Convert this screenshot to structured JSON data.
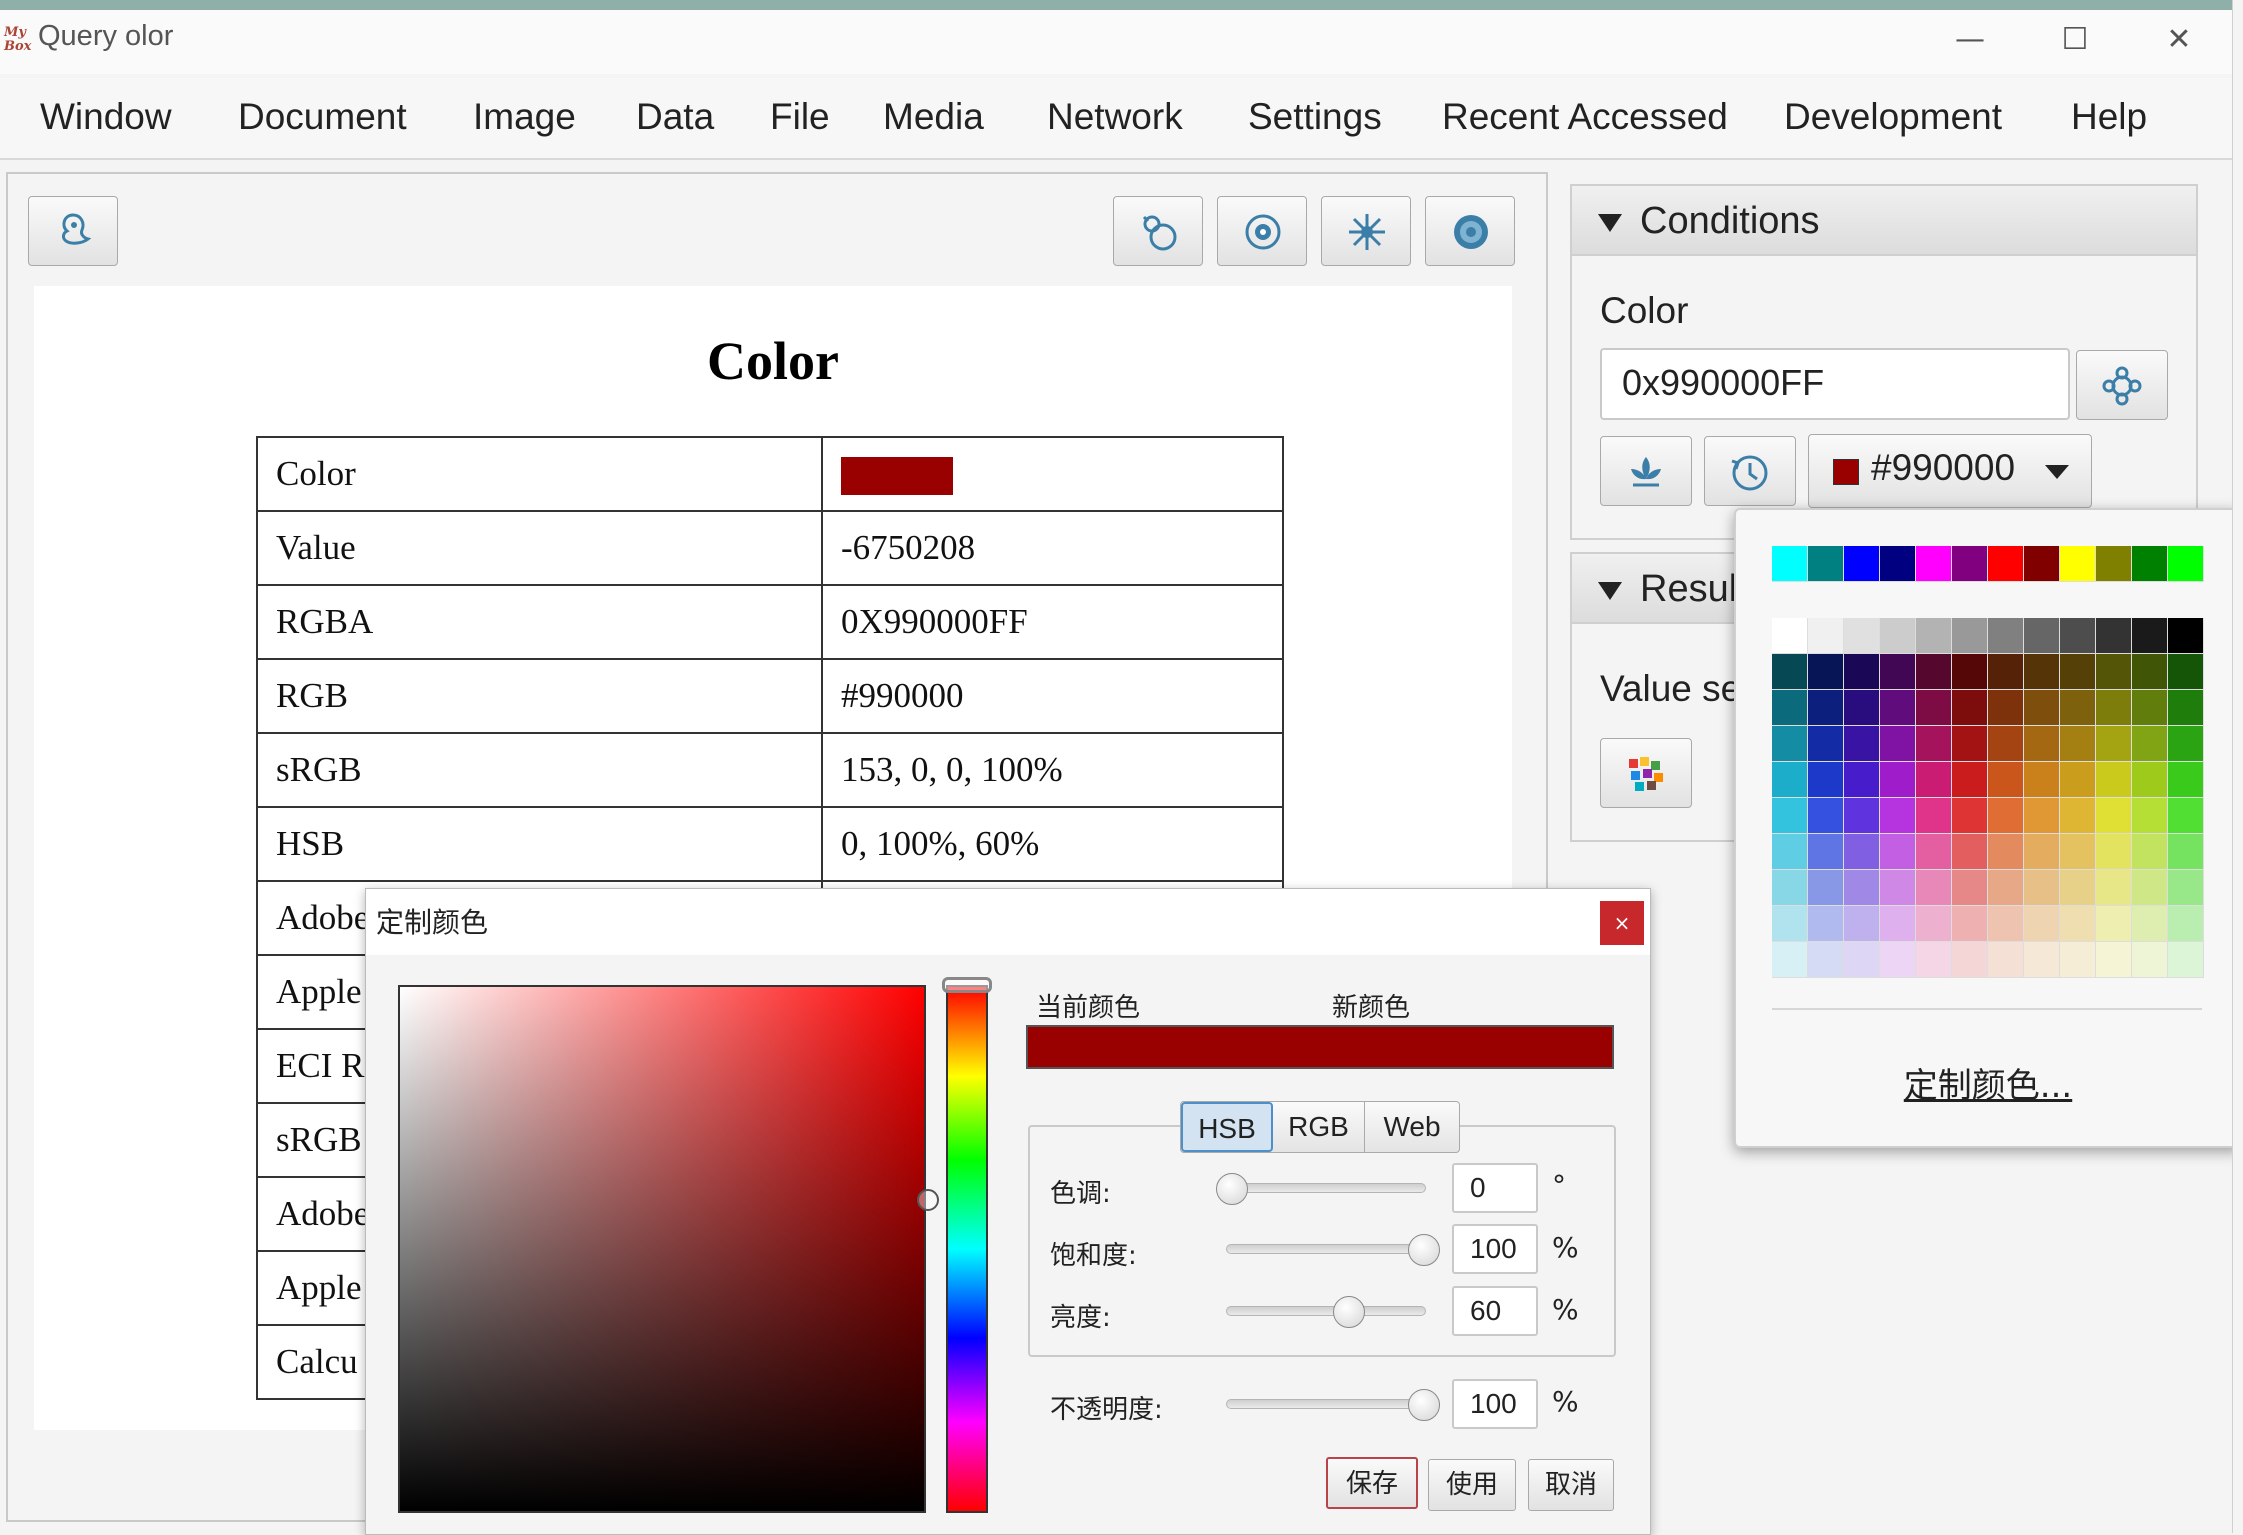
{
  "window": {
    "title": "Query olor",
    "logo_text": "My Box"
  },
  "menu": [
    "Window",
    "Document",
    "Image",
    "Data",
    "File",
    "Media",
    "Network",
    "Settings",
    "Recent Accessed",
    "Development",
    "Help"
  ],
  "document": {
    "heading": "Color",
    "rows": [
      {
        "key": "Color",
        "value": ""
      },
      {
        "key": "Value",
        "value": "-6750208"
      },
      {
        "key": "RGBA",
        "value": "0X990000FF"
      },
      {
        "key": "RGB",
        "value": "#990000"
      },
      {
        "key": "sRGB",
        "value": "153, 0, 0, 100%"
      },
      {
        "key": "HSB",
        "value": "0, 100%, 60%"
      },
      {
        "key": "Adobe",
        "value": ""
      },
      {
        "key": "Apple",
        "value": ""
      },
      {
        "key": "ECI R",
        "value": ""
      },
      {
        "key": "sRGB",
        "value": ""
      },
      {
        "key": "Adobe",
        "value": ""
      },
      {
        "key": "Apple",
        "value": ""
      },
      {
        "key": "Calcu",
        "value": ""
      }
    ],
    "swatch_color": "#990000"
  },
  "conditions": {
    "header": "Conditions",
    "color_label": "Color",
    "color_value": "0x990000FF",
    "picker_value": "#990000"
  },
  "results": {
    "header": "Resul",
    "value_label": "Value se"
  },
  "palette_popup": {
    "custom_link": "定制颜色..."
  },
  "dialog": {
    "title": "定制颜色",
    "current_label": "当前颜色",
    "new_label": "新颜色",
    "preview_color": "#990000",
    "tabs": [
      "HSB",
      "RGB",
      "Web"
    ],
    "selected_tab": "HSB",
    "hue": {
      "label": "色调:",
      "value": "0",
      "unit": "°"
    },
    "saturation": {
      "label": "饱和度:",
      "value": "100",
      "unit": "%"
    },
    "brightness": {
      "label": "亮度:",
      "value": "60",
      "unit": "%"
    },
    "opacity": {
      "label": "不透明度:",
      "value": "100",
      "unit": "%"
    },
    "buttons": {
      "save": "保存",
      "use": "使用",
      "cancel": "取消"
    },
    "close_symbol": "×"
  }
}
